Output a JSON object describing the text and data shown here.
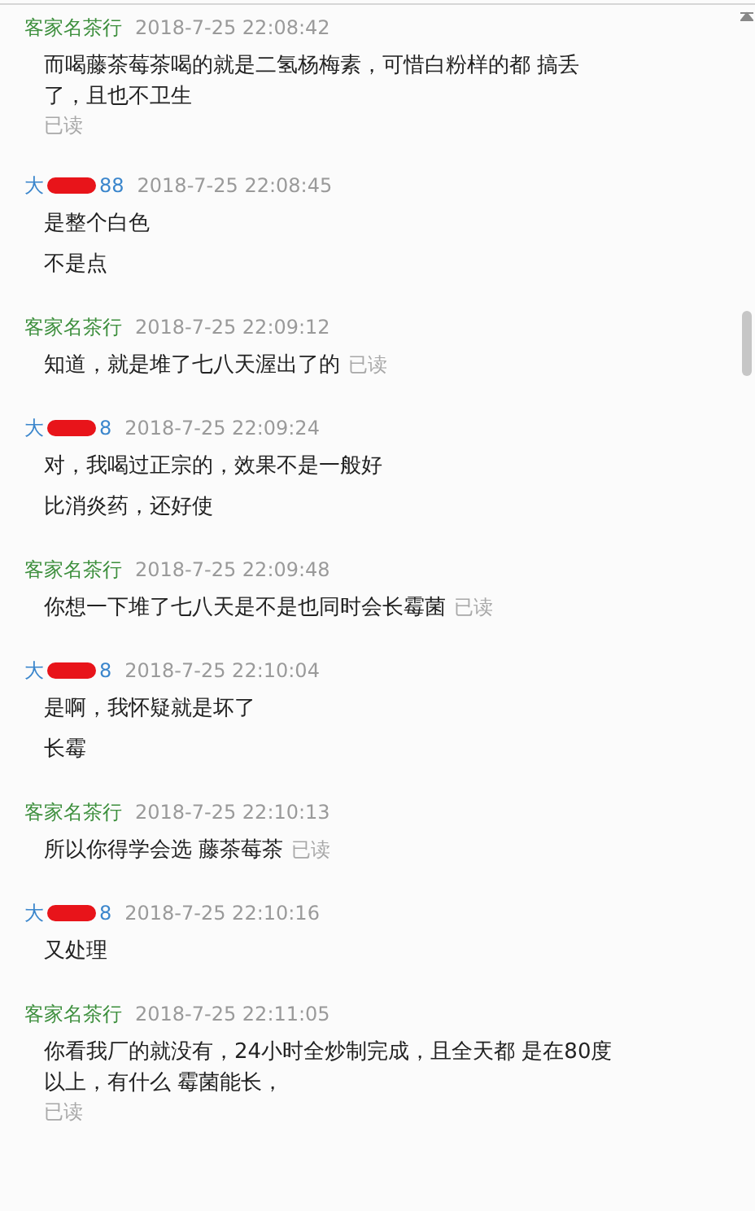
{
  "chat": [
    {
      "sender": {
        "kind": "shop",
        "name": "客家名茶行"
      },
      "time": "2018-7-25 22:08:42",
      "messages": [
        {
          "text": "而喝藤茶莓茶喝的就是二氢杨梅素，可惜白粉样的都 搞丢了，且也不卫生",
          "receipt": "已读",
          "receipt_on_new_line": true
        }
      ]
    },
    {
      "sender": {
        "kind": "customer",
        "name": "大",
        "name_tail": "88"
      },
      "time": "2018-7-25 22:08:45",
      "messages": [
        {
          "text": "是整个白色"
        },
        {
          "text": "不是点"
        }
      ]
    },
    {
      "sender": {
        "kind": "shop",
        "name": "客家名茶行"
      },
      "time": "2018-7-25 22:09:12",
      "messages": [
        {
          "text": "知道，就是堆了七八天渥出了的",
          "receipt": "已读",
          "receipt_on_new_line": false
        }
      ]
    },
    {
      "sender": {
        "kind": "customer",
        "name": "大",
        "name_tail": "8"
      },
      "time": "2018-7-25 22:09:24",
      "messages": [
        {
          "text": "对，我喝过正宗的，效果不是一般好"
        },
        {
          "text": "比消炎药，还好使"
        }
      ]
    },
    {
      "sender": {
        "kind": "shop",
        "name": "客家名茶行"
      },
      "time": "2018-7-25 22:09:48",
      "messages": [
        {
          "text": "你想一下堆了七八天是不是也同时会长霉菌",
          "receipt": "已读",
          "receipt_on_new_line": false
        }
      ]
    },
    {
      "sender": {
        "kind": "customer",
        "name": "大",
        "name_tail": "8"
      },
      "time": "2018-7-25 22:10:04",
      "messages": [
        {
          "text": "是啊，我怀疑就是坏了"
        },
        {
          "text": "长霉"
        }
      ]
    },
    {
      "sender": {
        "kind": "shop",
        "name": "客家名茶行"
      },
      "time": "2018-7-25 22:10:13",
      "messages": [
        {
          "text": "所以你得学会选 藤茶莓茶",
          "receipt": "已读",
          "receipt_on_new_line": false
        }
      ]
    },
    {
      "sender": {
        "kind": "customer",
        "name": "大",
        "name_tail": "8"
      },
      "time": "2018-7-25 22:10:16",
      "messages": [
        {
          "text": "又处理"
        }
      ]
    },
    {
      "sender": {
        "kind": "shop",
        "name": "客家名茶行"
      },
      "time": "2018-7-25 22:11:05",
      "messages": [
        {
          "text": "你看我厂的就没有，24小时全炒制完成，且全天都 是在80度以上，有什么 霉菌能长，",
          "receipt": "已读",
          "receipt_on_new_line": true
        }
      ]
    }
  ]
}
